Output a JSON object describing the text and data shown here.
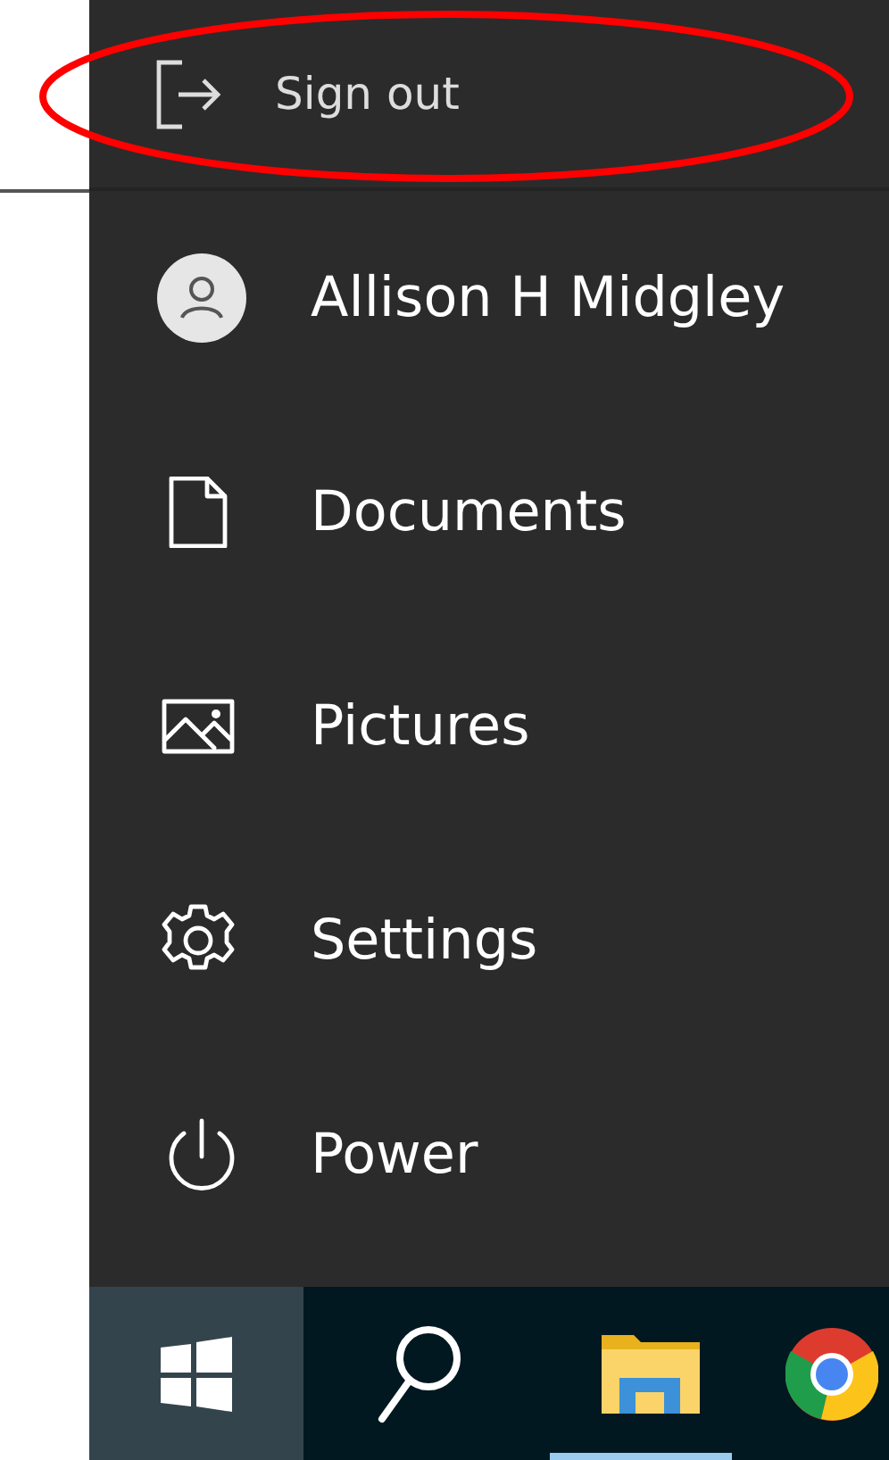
{
  "flyout": [
    {
      "label": "Sign out",
      "kind": "sign-out",
      "circled": true
    }
  ],
  "menu": {
    "items": [
      {
        "label": "Allison H Midgley",
        "kind": "avatar"
      },
      {
        "label": "Documents",
        "kind": "document"
      },
      {
        "label": "Pictures",
        "kind": "pictures"
      },
      {
        "label": "Settings",
        "kind": "settings"
      },
      {
        "label": "Power",
        "kind": "power"
      }
    ]
  },
  "taskbar": {
    "items": [
      {
        "kind": "start",
        "selected": true,
        "running": false
      },
      {
        "kind": "search",
        "selected": false,
        "running": false
      },
      {
        "kind": "explorer",
        "selected": false,
        "running": true
      },
      {
        "kind": "browser",
        "selected": false,
        "running": false
      }
    ]
  }
}
